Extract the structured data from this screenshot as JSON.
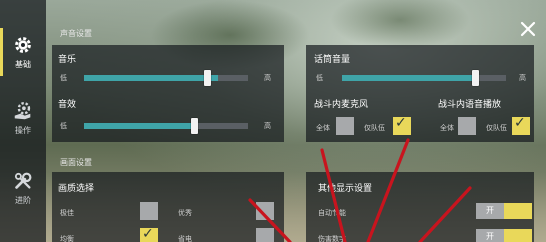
{
  "colors": {
    "accent": "#e9d85a",
    "slider_fill": "#3fa4a8",
    "arrow": "#c8141e"
  },
  "sidebar": {
    "tabs": [
      {
        "label": "基础",
        "icon": "gear-icon",
        "active": true
      },
      {
        "label": "操作",
        "icon": "gear-hand-icon",
        "active": false
      },
      {
        "label": "进阶",
        "icon": "wrench-icon",
        "active": false
      }
    ]
  },
  "audio": {
    "header": "声音设置",
    "music": {
      "title": "音乐",
      "low": "低",
      "high": "高",
      "level": 0.82
    },
    "sfx": {
      "title": "音效",
      "low": "低",
      "high": "高",
      "level": 0.67
    },
    "mic_volume": {
      "title": "话筒音量",
      "low": "低",
      "high": "高",
      "level": 0.82
    },
    "battle_mic": {
      "title": "战斗内麦克风",
      "all_label": "全体",
      "team_label": "仅队伍",
      "all_checked": false,
      "team_checked": true
    },
    "battle_voice": {
      "title": "战斗内语音播放",
      "all_label": "全体",
      "team_label": "仅队伍",
      "all_checked": false,
      "team_checked": true
    }
  },
  "graphics": {
    "header": "画面设置",
    "quality": {
      "title": "画质选择",
      "options": [
        {
          "label": "极佳",
          "checked": false
        },
        {
          "label": "优秀",
          "checked": false
        },
        {
          "label": "均衡",
          "checked": true
        },
        {
          "label": "省电",
          "checked": false
        }
      ]
    },
    "other": {
      "title": "其他显示设置",
      "rows": [
        {
          "label": "自动节能",
          "toggle": "开"
        },
        {
          "label": "伤害数字",
          "toggle": "开"
        }
      ]
    }
  }
}
